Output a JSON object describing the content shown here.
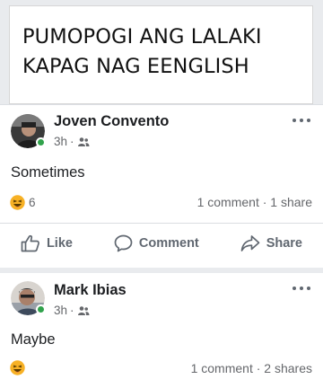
{
  "quote": {
    "line1": "PUMOPOGI ANG LALAKI",
    "line2": "KAPAG NAG EENGLISH"
  },
  "posts": [
    {
      "author": "Joven Convento",
      "time": "3h",
      "separator": "·",
      "audience_icon": "friends-icon",
      "text": "Sometimes",
      "reaction_icon": "haha-icon",
      "reaction_count": "6",
      "comments": "1 comment",
      "shares": "1 share",
      "count_separator": "·",
      "online": true
    },
    {
      "author": "Mark Ibias",
      "time": "3h",
      "separator": "·",
      "audience_icon": "friends-icon",
      "text": "Maybe",
      "reaction_icon": "haha-icon",
      "reaction_count": "",
      "comments": "1 comment",
      "shares": "2 shares",
      "count_separator": "·",
      "online": true
    }
  ],
  "actions": {
    "like": "Like",
    "comment": "Comment",
    "share": "Share"
  },
  "colors": {
    "online": "#31a24c",
    "reaction": "#f7b125",
    "meta": "#65676b"
  }
}
